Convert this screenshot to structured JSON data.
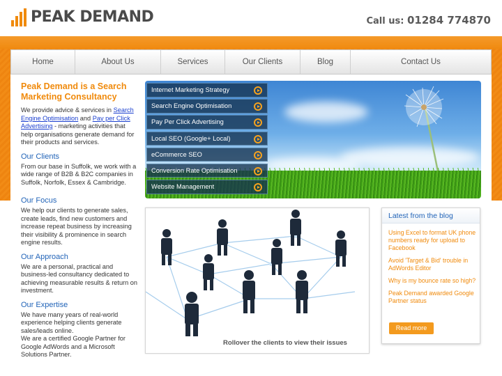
{
  "header": {
    "logo_text": "PEAK DEMAND",
    "call_label": "Call us:",
    "phone": "01284 774870"
  },
  "nav": {
    "items": [
      {
        "label": "Home"
      },
      {
        "label": "About Us"
      },
      {
        "label": "Services"
      },
      {
        "label": "Our Clients"
      },
      {
        "label": "Blog"
      },
      {
        "label": "Contact Us"
      }
    ]
  },
  "intro": {
    "title": "Peak Demand is a Search Marketing Consultancy",
    "text_before": "We provide advice & services in",
    "link1": "Search Engine Optimisation",
    "and": "and",
    "link2": "Pay per Click Advertising",
    "text_after": "- marketing activities that help organisations generate demand for their products and services."
  },
  "sections": [
    {
      "title": "Our Clients",
      "text": "From our base in Suffolk, we work with a wide range of B2B & B2C companies in Suffolk, Norfolk, Essex & Cambridge."
    },
    {
      "title": "Our Focus",
      "text": "We help our clients to generate sales, create leads, find new customers and increase repeat business by increasing their visibility & prominence in search engine results."
    },
    {
      "title": "Our Approach",
      "text": "We are a personal, practical and business-led consultancy dedicated to achieving measurable results & return on investment."
    },
    {
      "title": "Our Expertise",
      "text": "We have many years of real-world experience helping clients generate sales/leads online.",
      "text2": "We are a certified Google Partner for Google AdWords and a Microsoft Solutions Partner."
    }
  ],
  "services_menu": [
    {
      "label": "Internet Marketing Strategy"
    },
    {
      "label": "Search Engine Optimisation"
    },
    {
      "label": "Pay Per Click Advertising"
    },
    {
      "label": "Local SEO (Google+ Local)"
    },
    {
      "label": "eCommerce SEO"
    },
    {
      "label": "Conversion Rate Optimisation"
    },
    {
      "label": "Website Management"
    }
  ],
  "network": {
    "caption": "Rollover the clients to view their issues"
  },
  "blog": {
    "title": "Latest from the blog",
    "items": [
      {
        "label": "Using Excel to format UK phone numbers ready for upload to Facebook"
      },
      {
        "label": "Avoid 'Target & Bid' trouble in AdWords Editor"
      },
      {
        "label": "Why is my bounce rate so high?"
      },
      {
        "label": "Peak Demand awarded Google Partner status"
      }
    ],
    "read_more": "Read more"
  },
  "colors": {
    "accent_orange": "#f08a0c",
    "link_blue": "#2264b8"
  }
}
